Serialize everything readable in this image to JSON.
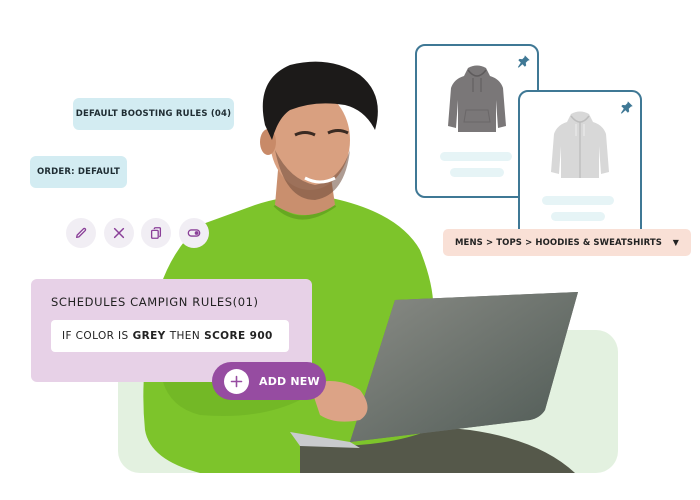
{
  "chips": {
    "boosting_rules": "DEFAULT BOOSTING RULES (04)",
    "order": "ORDER: DEFAULT"
  },
  "action_icons": [
    {
      "icon": "pencil-icon",
      "label": "edit"
    },
    {
      "icon": "close-icon",
      "label": "delete"
    },
    {
      "icon": "copy-icon",
      "label": "duplicate"
    },
    {
      "icon": "toggle-icon",
      "label": "toggle"
    }
  ],
  "campaign": {
    "title": "SCHEDULES CAMPIGN RULES(01)",
    "rule": {
      "prefix": "IF COLOR IS",
      "value": "GREY",
      "middle": "THEN",
      "result": "SCORE 900"
    },
    "add_button": "ADD NEW"
  },
  "products": [
    {
      "name": "dark grey hoodie",
      "color": "#7a7778",
      "pinned": true
    },
    {
      "name": "light grey zip hoodie",
      "color": "#d6d6d6",
      "pinned": true
    }
  ],
  "category_select": {
    "value": "MENS > TOPS > HOODIES & SWEATSHIRTS"
  },
  "colors": {
    "chip_bg": "#d3ecf2",
    "campaign_bg": "#e7d1e7",
    "accent_purple": "#964ca1",
    "card_border": "#3f7895",
    "breadcrumb_bg": "#f9e0d6",
    "hero_bg": "#e3f1e0",
    "sweater_green": "#7cc42a"
  }
}
